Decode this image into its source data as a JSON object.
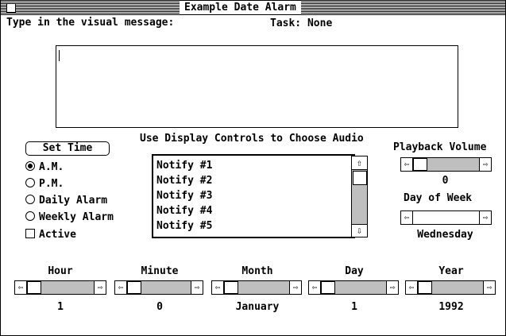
{
  "window": {
    "title": "Example Date Alarm"
  },
  "message": {
    "label": "Type in the visual message:",
    "task": "Task: None",
    "value": ""
  },
  "audio": {
    "label": "Use Display Controls to Choose Audio",
    "items": [
      "Notify #1",
      "Notify #2",
      "Notify #3",
      "Notify #4",
      "Notify #5"
    ]
  },
  "set_time_button": "Set Time",
  "options": [
    {
      "label": "A.M.",
      "selected": true
    },
    {
      "label": "P.M.",
      "selected": false
    },
    {
      "label": "Daily Alarm",
      "selected": false
    },
    {
      "label": "Weekly Alarm",
      "selected": false
    }
  ],
  "active": {
    "label": "Active",
    "checked": false
  },
  "playback": {
    "label": "Playback Volume",
    "value": "0"
  },
  "day_of_week": {
    "label": "Day of Week",
    "value": "Wednesday"
  },
  "date": {
    "hour": {
      "label": "Hour",
      "value": "1"
    },
    "minute": {
      "label": "Minute",
      "value": "0"
    },
    "month": {
      "label": "Month",
      "value": "January"
    },
    "day": {
      "label": "Day",
      "value": "1"
    },
    "year": {
      "label": "Year",
      "value": "1992"
    }
  },
  "icons": {
    "left_arrow": "⇦",
    "right_arrow": "⇨",
    "up_arrow": "⇧",
    "down_arrow": "⇩"
  }
}
